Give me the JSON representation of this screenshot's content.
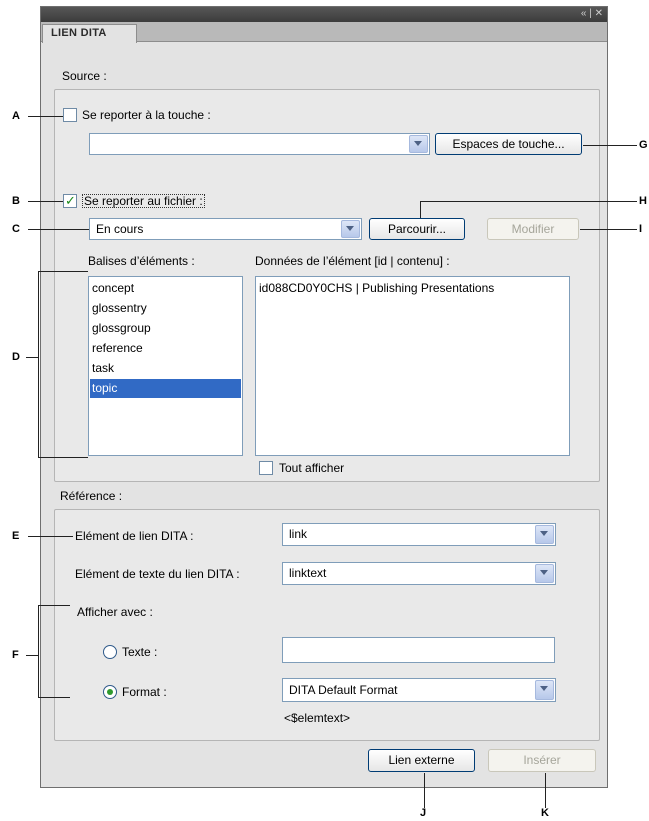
{
  "panel": {
    "tab_label": "LIEN DITA",
    "controls": "« | ✕"
  },
  "source": {
    "label": "Source :",
    "use_key_label": "Se reporter à la touche :",
    "use_key_checked": false,
    "key_value": "",
    "key_spaces_button": "Espaces de touche...",
    "use_file_label": "Se reporter au fichier :",
    "use_file_checked": true,
    "file_value": "En cours",
    "browse_button": "Parcourir...",
    "modify_button": "Modifier",
    "element_tags_label": "Balises d’éléments :",
    "element_tags": [
      "concept",
      "glossentry",
      "glossgroup",
      "reference",
      "task",
      "topic"
    ],
    "selected_tag": "topic",
    "element_data_label": "Données de l’élément [id | contenu] :",
    "element_data": [
      "id088CD0Y0CHS | Publishing Presentations"
    ],
    "show_all_label": "Tout afficher",
    "show_all_checked": false
  },
  "reference": {
    "label": "Référence :",
    "link_element_label": "Elément de lien DITA :",
    "link_element_value": "link",
    "link_text_element_label": "Elément de texte du lien DITA :",
    "link_text_element_value": "linktext",
    "display_with_label": "Afficher avec :",
    "text_option_label": "Texte :",
    "text_value": "",
    "format_option_label": "Format :",
    "format_value": "DITA Default Format",
    "format_preview": "<$elemtext>",
    "selected_option": "Format"
  },
  "footer": {
    "external_link_button": "Lien externe",
    "insert_button": "Insérer"
  },
  "callouts": [
    "A",
    "B",
    "C",
    "D",
    "E",
    "F",
    "G",
    "H",
    "I",
    "J",
    "K"
  ]
}
